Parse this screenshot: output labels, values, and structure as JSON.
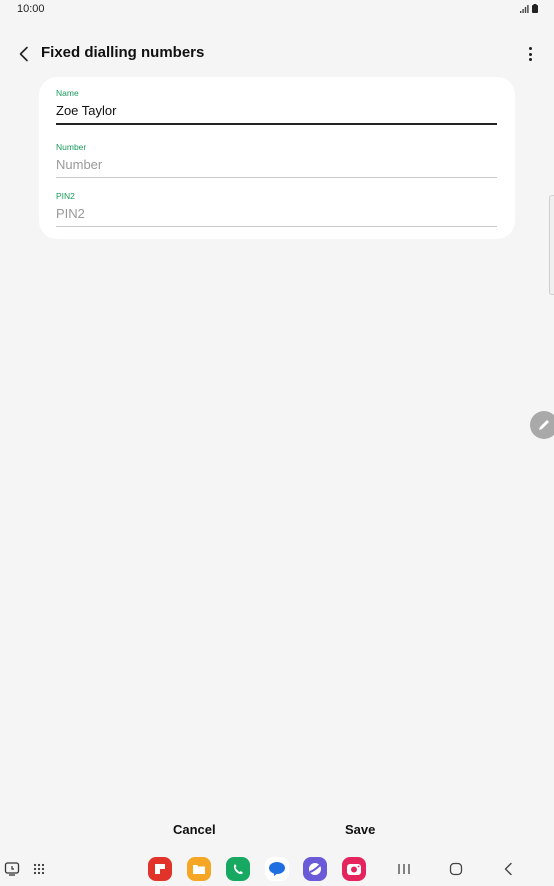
{
  "status_bar": {
    "time": "10:00"
  },
  "header": {
    "title": "Fixed dialling numbers"
  },
  "form": {
    "name": {
      "label": "Name",
      "value": "Zoe Taylor"
    },
    "number": {
      "label": "Number",
      "placeholder": "Number"
    },
    "pin2": {
      "label": "PIN2",
      "placeholder": "PIN2"
    }
  },
  "actions": {
    "cancel_label": "Cancel",
    "save_label": "Save"
  },
  "colors": {
    "accent": "#1a9a5c",
    "background": "#f5f5f5",
    "card": "#ffffff"
  },
  "nav_apps": [
    {
      "name": "flipboard-app",
      "color": "#e2332b"
    },
    {
      "name": "my-files-app",
      "color": "#f5a623"
    },
    {
      "name": "phone-app",
      "color": "#17a862"
    },
    {
      "name": "messages-app",
      "color": "#1f6fe0"
    },
    {
      "name": "internet-app",
      "color": "#6a5ad8"
    },
    {
      "name": "camera-app",
      "color": "#e5245e"
    }
  ]
}
